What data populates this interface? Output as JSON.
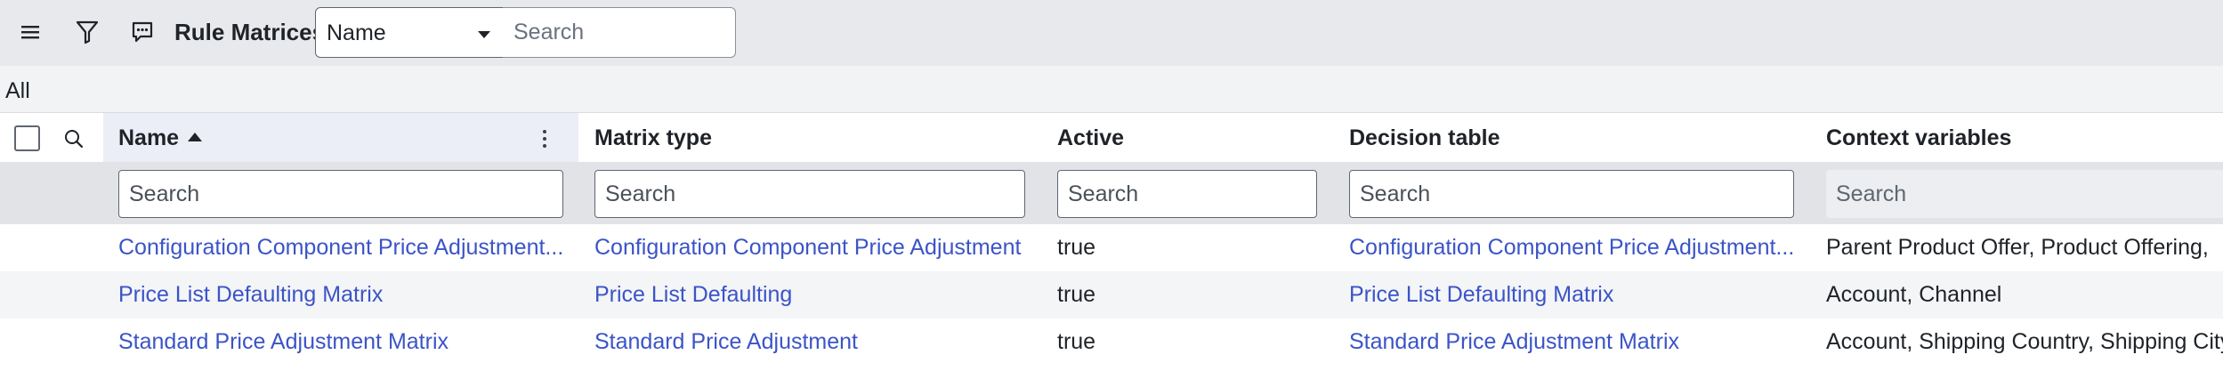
{
  "toolbar": {
    "menu_icon": "hamburger-icon",
    "filter_icon": "funnel-icon",
    "chat_icon": "chat-bubble-icon",
    "title": "Rule Matrices",
    "field_select": "Name",
    "search_placeholder": "Search"
  },
  "breadcrumb": "All",
  "table": {
    "headers": [
      "Name",
      "Matrix type",
      "Active",
      "Decision table",
      "Context variables"
    ],
    "sort_column": "Name",
    "sort_direction": "ascending",
    "filter_placeholder": "Search",
    "rows": [
      {
        "name": "Configuration Component Price Adjustment...",
        "matrix_type": "Configuration Component Price Adjustment",
        "active": "true",
        "decision_table": "Configuration Component Price Adjustment...",
        "context_variables": "Parent Product Offer, Product Offering,"
      },
      {
        "name": "Price List Defaulting Matrix",
        "matrix_type": "Price List Defaulting",
        "active": "true",
        "decision_table": "Price List Defaulting Matrix",
        "context_variables": "Account, Channel"
      },
      {
        "name": "Standard Price Adjustment Matrix",
        "matrix_type": "Standard Price Adjustment",
        "active": "true",
        "decision_table": "Standard Price Adjustment Matrix",
        "context_variables": "Account, Shipping Country, Shipping City"
      }
    ]
  },
  "colors": {
    "link": "#3b54c7",
    "toolbar_bg": "#e8e9ec",
    "filter_row_bg": "#e1e3e7",
    "sorted_column_bg": "#eceef7"
  }
}
